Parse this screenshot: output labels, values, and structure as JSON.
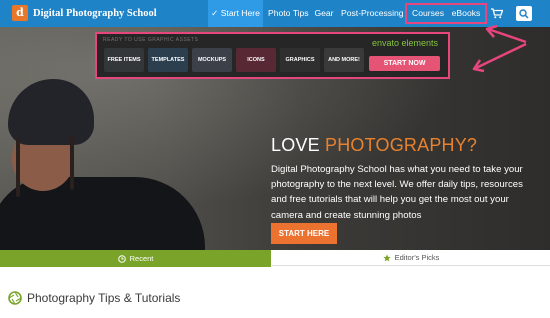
{
  "header": {
    "logo_letter": "dPS",
    "brand": "Digital Photography School",
    "nav": {
      "start_here": "✓ Start Here",
      "photo_tips": "Photo Tips",
      "gear": "Gear",
      "post_processing": "Post-Processing",
      "courses": "Courses",
      "ebooks": "eBooks"
    },
    "icons": {
      "cart": "cart-icon",
      "search": "search-icon"
    }
  },
  "ad": {
    "kicker": "READY TO USE GRAPHIC ASSETS",
    "tiles": [
      "FREE ITEMS",
      "TEMPLATES",
      "MOCKUPS",
      "ICONS",
      "GRAPHICS",
      "AND MORE!"
    ],
    "logo": "envato elements",
    "cta": "START NOW"
  },
  "hero": {
    "title_plain": "LOVE ",
    "title_accent": "PHOTOGRAPHY?",
    "body": "Digital Photography School has what you need to take your photography to the next level. We offer daily tips, resources and free tutorials that will help you get the most out your camera and create stunning photos",
    "cta": "START HERE"
  },
  "tabs": {
    "recent": "Recent",
    "editors_picks": "Editor's Picks"
  },
  "section": {
    "title": "Photography Tips & Tutorials"
  },
  "colors": {
    "nav_blue": "#1f83c7",
    "nav_active": "#2f9be6",
    "highlight_pink": "#e6457e",
    "orange": "#ec7230",
    "green": "#7aa429"
  }
}
